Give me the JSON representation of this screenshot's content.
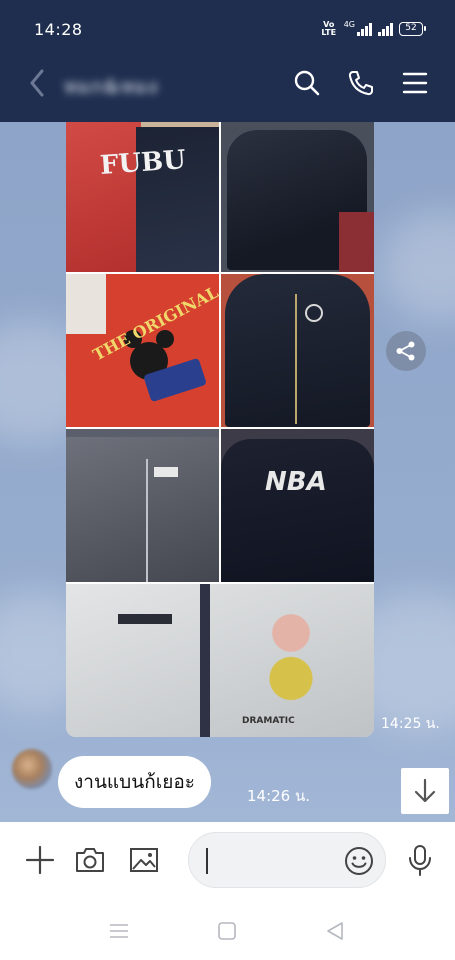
{
  "status_bar": {
    "time": "14:28",
    "volte": "Vo LTE",
    "network": "4G",
    "battery": "52"
  },
  "header": {
    "title": "หมก&หมง",
    "back_icon": "chevron-left-icon",
    "search_icon": "search-icon",
    "call_icon": "phone-icon",
    "menu_icon": "menu-icon"
  },
  "messages": [
    {
      "type": "image-album",
      "photos": [
        {
          "name": "fubu-jacket",
          "caption": "FUBU"
        },
        {
          "name": "dark-hooded-jacket",
          "caption": ""
        },
        {
          "name": "mickey-jacket",
          "caption": "THE ORIGINAL"
        },
        {
          "name": "navy-bomber-jacket",
          "caption": ""
        },
        {
          "name": "grey-zip-jacket",
          "caption": ""
        },
        {
          "name": "nba-hoodie",
          "caption": "NBA"
        },
        {
          "name": "white-cartoon-jacket",
          "caption": "DRAMATIC"
        }
      ],
      "time": "14:25 น."
    },
    {
      "type": "text",
      "text": "งานแบนก้เยอะ",
      "time": "14:26 น."
    }
  ],
  "actions": {
    "share_icon": "share-icon",
    "scroll_down_icon": "arrow-down-icon"
  },
  "input_bar": {
    "placeholder": "",
    "add_icon": "plus-icon",
    "camera_icon": "camera-icon",
    "gallery_icon": "image-icon",
    "emoji_icon": "smiley-icon",
    "mic_icon": "microphone-icon"
  },
  "nav": {
    "recents_icon": "recents-icon",
    "home_icon": "home-icon",
    "back_icon": "back-triangle-icon"
  },
  "colors": {
    "header_bg": "#1f2e4f",
    "chat_bg": "#93a9cc",
    "bubble_bg": "#ffffff"
  }
}
